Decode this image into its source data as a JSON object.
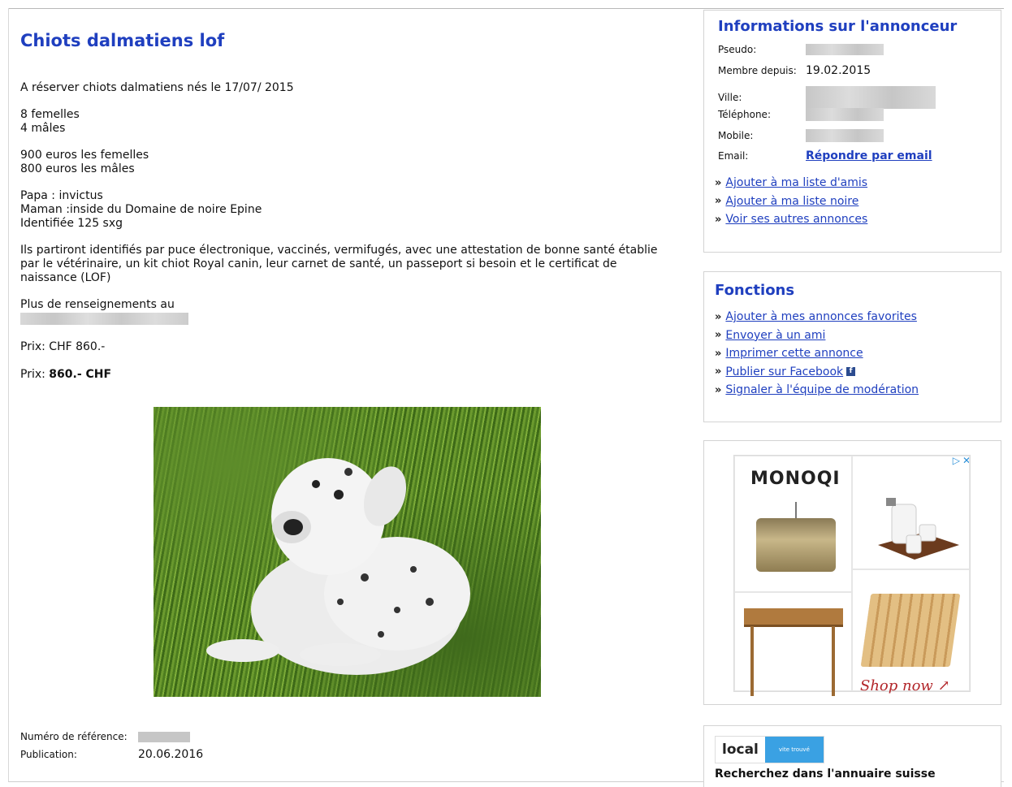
{
  "listing": {
    "title": "Chiots dalmatiens lof",
    "paragraphs": [
      [
        "A réserver chiots dalmatiens nés le 17/07/ 2015"
      ],
      [
        "8 femelles",
        "4 mâles"
      ],
      [
        "900 euros les femelles",
        "800 euros les mâles"
      ],
      [
        "Papa : invictus",
        "Maman :inside du Domaine de noire Epine",
        "Identifiée 125 sxg"
      ],
      [
        "Ils partiront identifiés par puce électronique, vaccinés, vermifugés, avec une attestation de bonne santé établie",
        "par le vétérinaire, un kit chiot Royal canin, leur carnet de santé, un passeport si besoin et le certificat de",
        "naissance (LOF)"
      ]
    ],
    "more_info": "Plus de renseignements au",
    "price_line": "Prix: CHF 860.-",
    "price_label": "Prix: ",
    "price_value": "860.- CHF",
    "ref_label": "Numéro de référence:",
    "pub_label": "Publication:",
    "pub_value": "20.06.2016"
  },
  "seller": {
    "title": "Informations sur l'annonceur",
    "pseudo_label": "Pseudo:",
    "member_label": "Membre depuis:",
    "member_value": "19.02.2015",
    "city_label": "Ville:",
    "phone_label": "Téléphone:",
    "mobile_label": "Mobile:",
    "email_label": "Email:",
    "email_link": "Répondre par email",
    "links": [
      "Ajouter à ma liste d'amis",
      "Ajouter à ma liste noire",
      "Voir ses autres annonces"
    ]
  },
  "functions": {
    "title": "Fonctions",
    "links": [
      "Ajouter à mes annonces favorites",
      "Envoyer à un ami",
      "Imprimer cette annonce",
      "Publier sur Facebook",
      "Signaler à l'équipe de modération"
    ]
  },
  "ad": {
    "brand": "MONOQI",
    "cta": "Shop now",
    "icons": [
      "adchoices-icon",
      "close-icon"
    ]
  },
  "local": {
    "logo_text": "local",
    "tagline": "vite trouvé",
    "search_text": "Recherchez dans l'annuaire suisse"
  }
}
